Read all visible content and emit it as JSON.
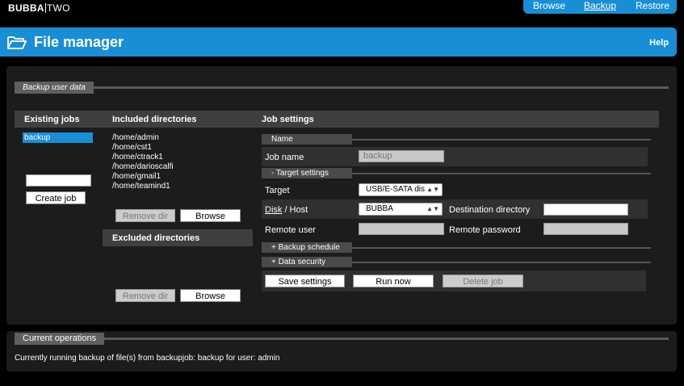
{
  "brand": {
    "part1": "BUBBA",
    "part2": "TWO"
  },
  "topnav": {
    "items": [
      "Browse",
      "Backup",
      "Restore"
    ],
    "active": "Backup"
  },
  "header": {
    "title": "File manager",
    "help": "Help"
  },
  "backup_panel": {
    "legend": "Backup user data",
    "col_existing": "Existing jobs",
    "col_included": "Included directories",
    "col_settings": "Job settings",
    "jobs": [
      "backup"
    ],
    "new_job_value": "",
    "create_job": "Create job",
    "included_dirs": [
      "/home/admin",
      "/home/cst1",
      "/home/ctrack1",
      "/home/darioscalfi",
      "/home/gmail1",
      "/home/teamind1"
    ],
    "remove_dir": "Remove dir",
    "browse": "Browse",
    "excluded_title": "Excluded directories",
    "settings": {
      "name_tab": "Name",
      "job_name_label": "Job name",
      "job_name_value": "backup",
      "target_tab": "-  Target settings",
      "target_label": "Target",
      "target_value": "USB/E-SATA disk",
      "disk_label": "Disk",
      "host_label": " / Host",
      "disk_value": "BUBBA",
      "dest_dir_label": "Destination directory",
      "dest_dir_value": "",
      "remote_user_label": "Remote user",
      "remote_user_value": "",
      "remote_password_label": "Remote password",
      "remote_password_value": "",
      "schedule_tab": "+  Backup schedule",
      "security_tab": "+  Data security",
      "save": "Save settings",
      "run": "Run now",
      "delete": "Delete job"
    }
  },
  "operations_panel": {
    "legend": "Current operations",
    "message": "Currently running backup of file(s) from backupjob: backup for user: admin"
  },
  "colors": {
    "accent": "#1a8ed4",
    "panel": "#1c1c1c",
    "selected": "#1a8ed4"
  }
}
